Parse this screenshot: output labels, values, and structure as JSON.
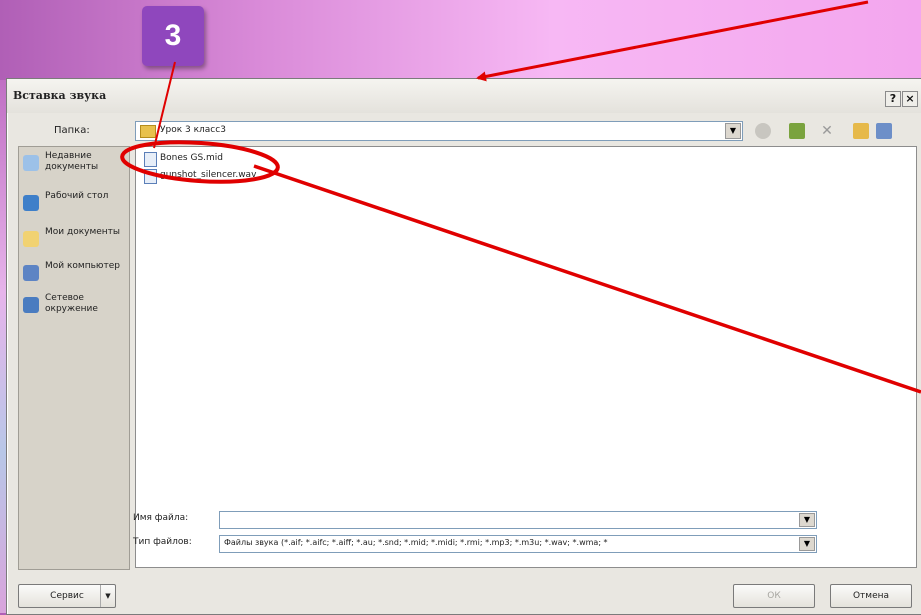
{
  "step_badge": "3",
  "dialog": {
    "title": "Вставка звука",
    "help_btn": "?",
    "close_btn": "×",
    "lookin_label": "Папка:",
    "lookin_value": "Урок 3 класс3",
    "places": [
      {
        "label": "Недавние документы",
        "icon": "recent-docs-icon"
      },
      {
        "label": "Рабочий стол",
        "icon": "desktop-icon"
      },
      {
        "label": "Мои документы",
        "icon": "my-documents-icon"
      },
      {
        "label": "Мой компьютер",
        "icon": "my-computer-icon"
      },
      {
        "label": "Сетевое окружение",
        "icon": "network-icon"
      }
    ],
    "files": [
      {
        "name": "Bones GS.mid"
      },
      {
        "name": "gunshot_silencer.wav"
      }
    ],
    "filename_label": "Имя файла:",
    "filename_value": "",
    "filetype_label": "Тип файлов:",
    "filetype_value": "Файлы звука (*.aif; *.aifc; *.aiff; *.au; *.snd; *.mid; *.midi; *.rmi; *.mp3; *.m3u; *.wav; *.wma; *",
    "tools_btn": "Сервис",
    "ok_btn": "ОК",
    "cancel_btn": "Отмена"
  },
  "colors": {
    "annotation": "#e00000",
    "badge": "#8f47bd"
  }
}
